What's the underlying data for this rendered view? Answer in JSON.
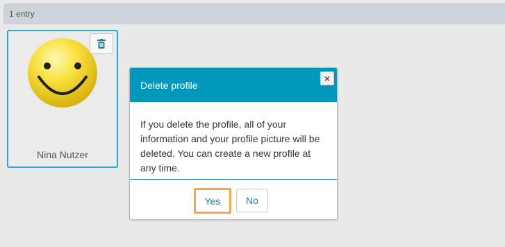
{
  "header": {
    "entry_count": "1 entry"
  },
  "profile": {
    "name": "Nina Nutzer",
    "avatar_icon": "smiley-face-icon",
    "delete_icon": "trash-icon"
  },
  "dialog": {
    "title": "Delete profile",
    "close_label": "×",
    "message": "If you delete the profile, all of your information and your profile picture will be deleted. You can create a new profile at any time.",
    "yes_label": "Yes",
    "no_label": "No"
  },
  "colors": {
    "accent": "#0099bb",
    "selected_border": "#2fa3c9",
    "focus_outline": "#f5a54a"
  }
}
